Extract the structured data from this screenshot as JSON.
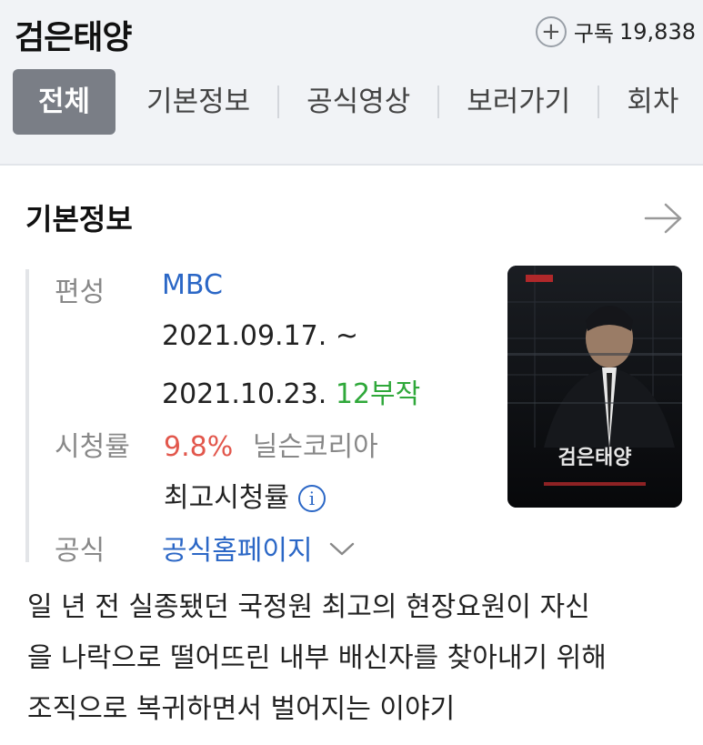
{
  "header": {
    "title": "검은태양",
    "subscribe_label": "구독",
    "subscribe_count": "19,838",
    "plus_icon": "plus-circle-icon"
  },
  "tabs": [
    {
      "label": "전체",
      "active": true
    },
    {
      "label": "기본정보",
      "active": false
    },
    {
      "label": "공식영상",
      "active": false
    },
    {
      "label": "보러가기",
      "active": false
    },
    {
      "label": "회차",
      "active": false
    }
  ],
  "basic_info": {
    "section_title": "기본정보",
    "broadcast_label": "편성",
    "broadcast_value": "MBC",
    "date_start": "2021.09.17. ~",
    "date_end": "2021.10.23.",
    "episodes": "12부작",
    "rating_label": "시청률",
    "rating_value": "9.8%",
    "rating_source": "닐슨코리아",
    "peak_rating": "최고시청률",
    "official_label": "공식",
    "official_value": "공식홈페이지",
    "poster_title": "검은태양"
  },
  "description": [
    "일 년 전 실종됐던 국정원 최고의 현장요원이 자신",
    "을 나락으로 떨어뜨린 내부 배신자를 찾아내기 위해",
    "조직으로 복귀하면서 벌어지는 이야기"
  ],
  "colors": {
    "link_blue": "#2b67c6",
    "green": "#2fa83a",
    "red": "#e2574c",
    "tab_active": "#7a7e86"
  }
}
